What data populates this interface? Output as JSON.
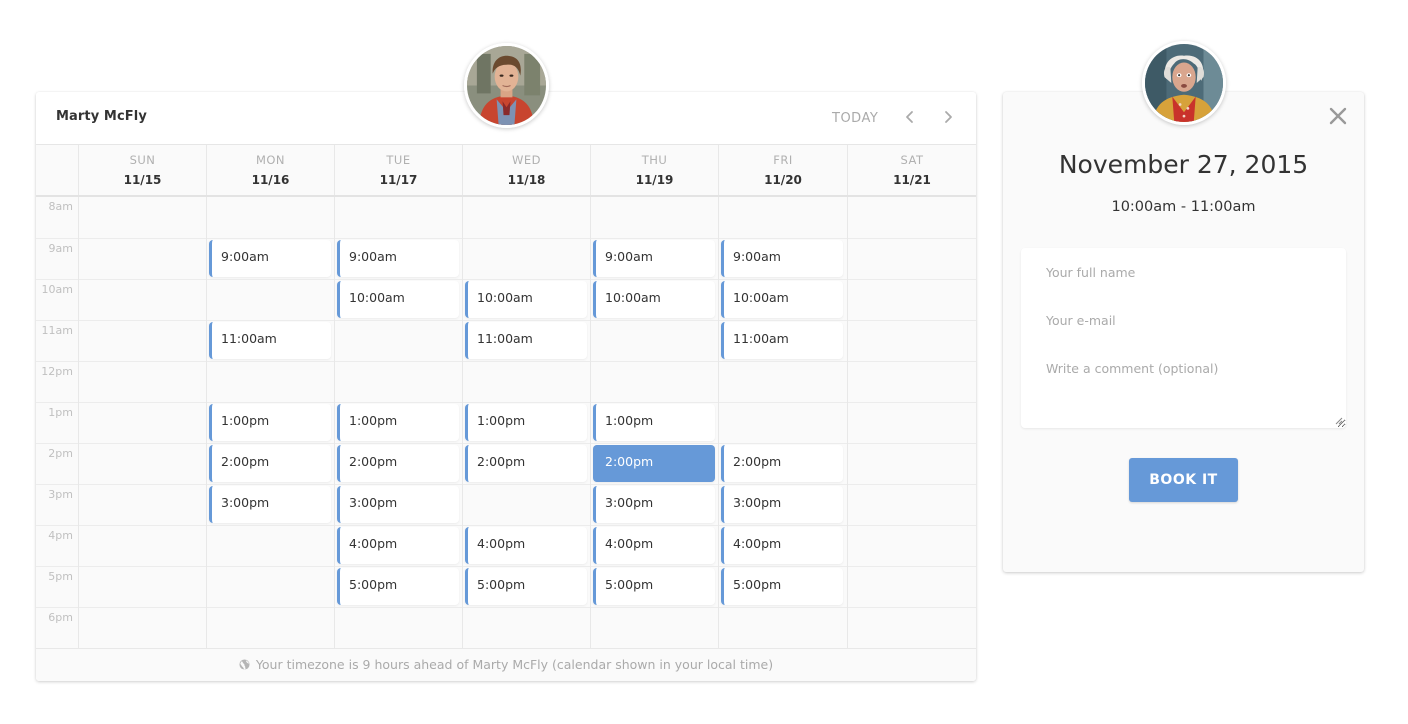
{
  "calendar": {
    "owner_name": "Marty McFly",
    "today_label": "TODAY",
    "prev_icon": "chevron-left-icon",
    "next_icon": "chevron-right-icon",
    "days": [
      {
        "dow": "SUN",
        "date": "11/15"
      },
      {
        "dow": "MON",
        "date": "11/16"
      },
      {
        "dow": "TUE",
        "date": "11/17"
      },
      {
        "dow": "WED",
        "date": "11/18"
      },
      {
        "dow": "THU",
        "date": "11/19"
      },
      {
        "dow": "FRI",
        "date": "11/20"
      },
      {
        "dow": "SAT",
        "date": "11/21"
      }
    ],
    "hours": [
      "8am",
      "9am",
      "10am",
      "11am",
      "12pm",
      "1pm",
      "2pm",
      "3pm",
      "4pm",
      "5pm",
      "6pm"
    ],
    "slots": [
      {
        "day": 1,
        "hour": 1,
        "label": "9:00am"
      },
      {
        "day": 1,
        "hour": 3,
        "label": "11:00am"
      },
      {
        "day": 1,
        "hour": 5,
        "label": "1:00pm"
      },
      {
        "day": 1,
        "hour": 6,
        "label": "2:00pm"
      },
      {
        "day": 1,
        "hour": 7,
        "label": "3:00pm"
      },
      {
        "day": 2,
        "hour": 1,
        "label": "9:00am"
      },
      {
        "day": 2,
        "hour": 2,
        "label": "10:00am"
      },
      {
        "day": 2,
        "hour": 5,
        "label": "1:00pm"
      },
      {
        "day": 2,
        "hour": 6,
        "label": "2:00pm"
      },
      {
        "day": 2,
        "hour": 7,
        "label": "3:00pm"
      },
      {
        "day": 2,
        "hour": 8,
        "label": "4:00pm"
      },
      {
        "day": 2,
        "hour": 9,
        "label": "5:00pm"
      },
      {
        "day": 3,
        "hour": 2,
        "label": "10:00am"
      },
      {
        "day": 3,
        "hour": 3,
        "label": "11:00am"
      },
      {
        "day": 3,
        "hour": 5,
        "label": "1:00pm"
      },
      {
        "day": 3,
        "hour": 6,
        "label": "2:00pm"
      },
      {
        "day": 3,
        "hour": 8,
        "label": "4:00pm"
      },
      {
        "day": 3,
        "hour": 9,
        "label": "5:00pm"
      },
      {
        "day": 4,
        "hour": 1,
        "label": "9:00am"
      },
      {
        "day": 4,
        "hour": 2,
        "label": "10:00am"
      },
      {
        "day": 4,
        "hour": 5,
        "label": "1:00pm"
      },
      {
        "day": 4,
        "hour": 6,
        "label": "2:00pm",
        "selected": true
      },
      {
        "day": 4,
        "hour": 7,
        "label": "3:00pm"
      },
      {
        "day": 4,
        "hour": 8,
        "label": "4:00pm"
      },
      {
        "day": 4,
        "hour": 9,
        "label": "5:00pm"
      },
      {
        "day": 5,
        "hour": 1,
        "label": "9:00am"
      },
      {
        "day": 5,
        "hour": 2,
        "label": "10:00am"
      },
      {
        "day": 5,
        "hour": 3,
        "label": "11:00am"
      },
      {
        "day": 5,
        "hour": 6,
        "label": "2:00pm"
      },
      {
        "day": 5,
        "hour": 7,
        "label": "3:00pm"
      },
      {
        "day": 5,
        "hour": 8,
        "label": "4:00pm"
      },
      {
        "day": 5,
        "hour": 9,
        "label": "5:00pm"
      }
    ],
    "footer_icon": "globe-icon",
    "footer_text": "Your timezone is 9 hours ahead of Marty McFly (calendar shown in your local time)"
  },
  "booking": {
    "close_icon": "close-icon",
    "date": "November 27, 2015",
    "time_range": "10:00am - 11:00am",
    "name_placeholder": "Your full name",
    "email_placeholder": "Your e-mail",
    "comment_placeholder": "Write a comment (optional)",
    "name_value": "",
    "email_value": "",
    "comment_value": "",
    "submit_label": "BOOK IT"
  },
  "avatars": {
    "host": "Marty McFly",
    "guest": "Doc Brown"
  },
  "colors": {
    "accent": "#6699d8",
    "muted_text": "#aaaaaa",
    "background": "#fafafa"
  }
}
